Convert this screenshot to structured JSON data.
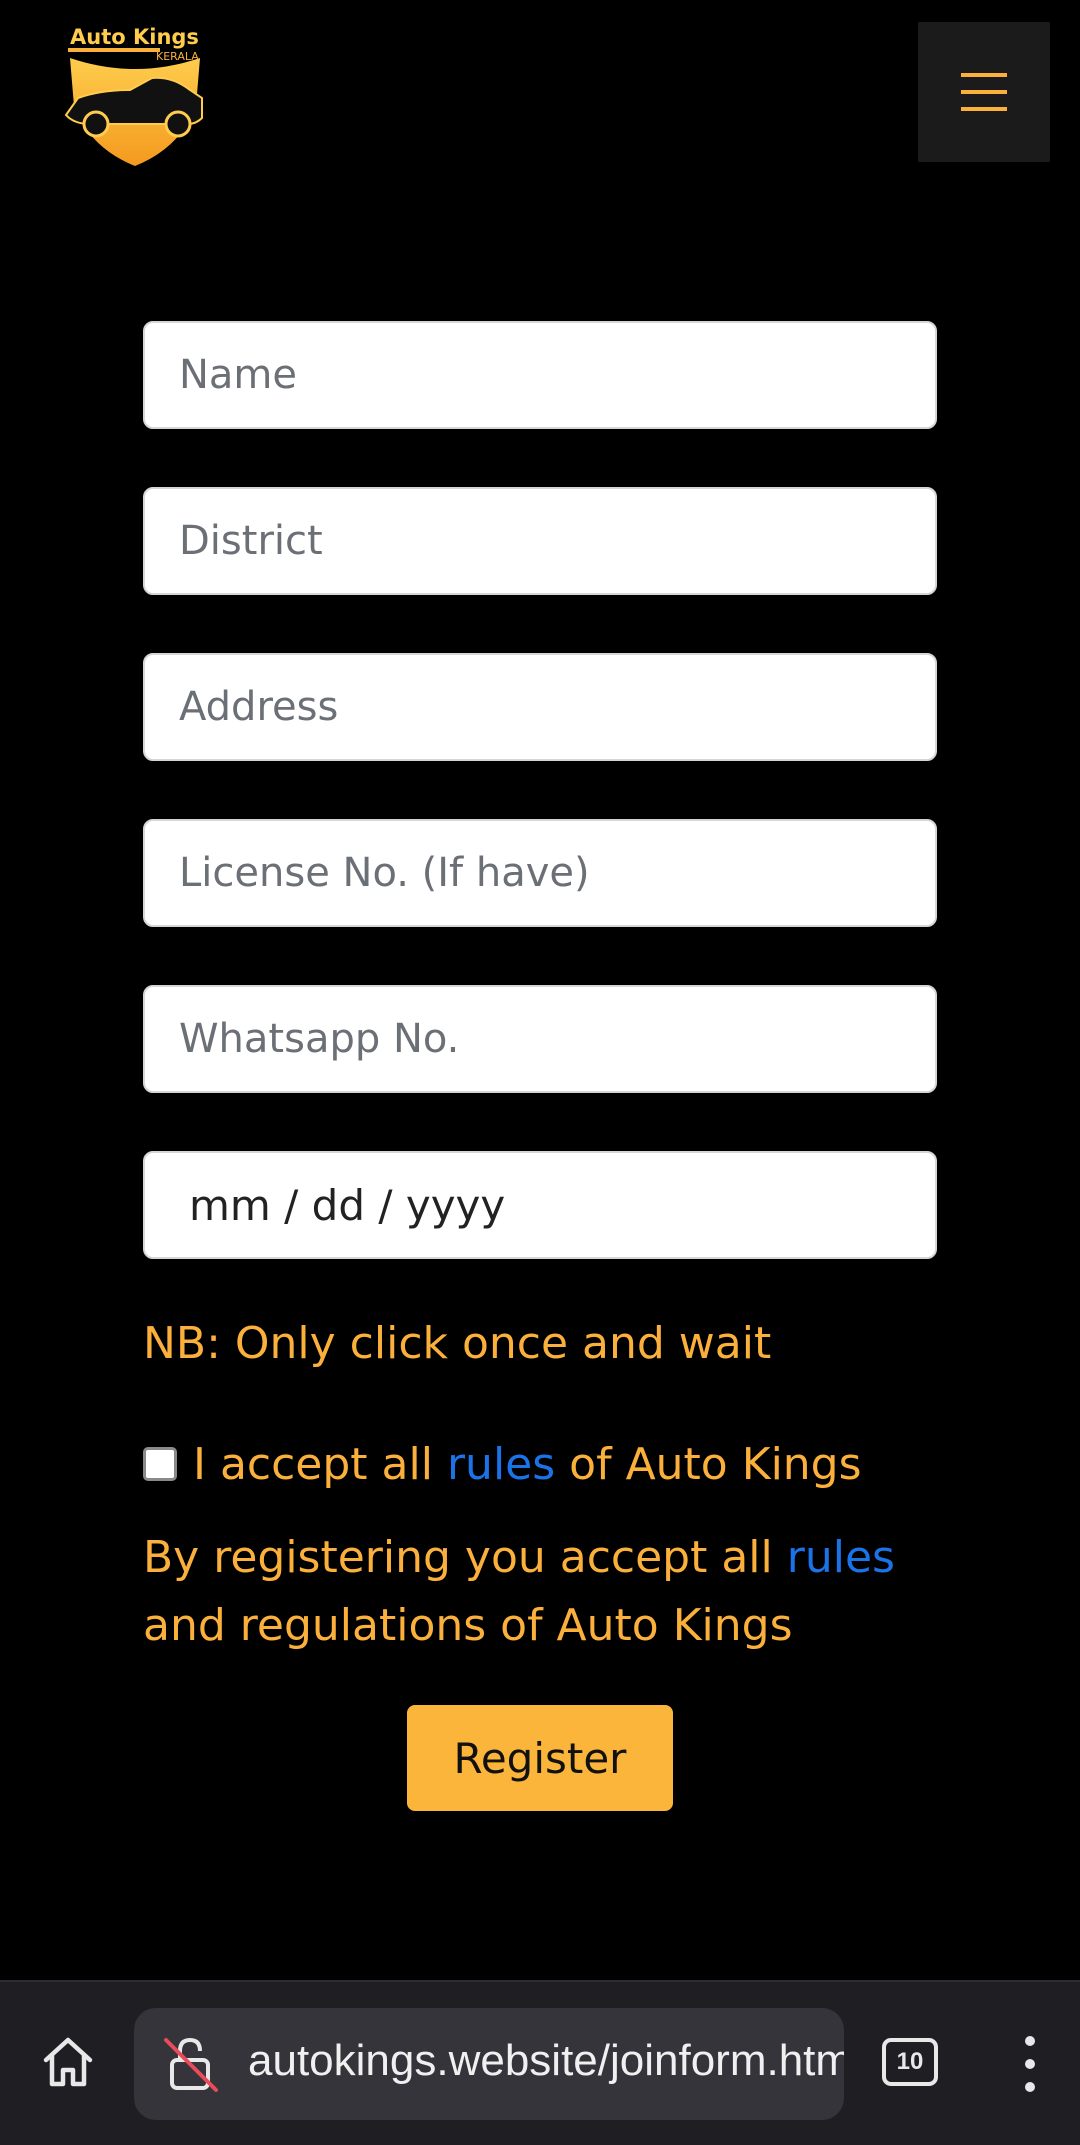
{
  "header": {
    "logo": {
      "title": "Auto Kings",
      "subtitle": "KERALA",
      "icon": "car-shield-logo"
    },
    "menu_icon": "hamburger-menu-icon"
  },
  "form": {
    "name_placeholder": "Name",
    "district_placeholder": "District",
    "address_placeholder": "Address",
    "license_placeholder": "License No. (If have)",
    "whatsapp_placeholder": "Whatsapp No.",
    "date_placeholder": "mm / dd / yyyy"
  },
  "note": "NB: Only click once and wait",
  "accept": {
    "prefix": "I accept all",
    "link": "rules",
    "suffix": "of Auto Kings",
    "checked": false
  },
  "terms": {
    "prefix": "By registering you accept all",
    "link": "rules",
    "suffix": "and regulations of Auto Kings"
  },
  "register_label": "Register",
  "browser": {
    "url": "autokings.website/joinform.html",
    "tab_count": "10",
    "icons": [
      "home-icon",
      "insecure-lock-icon",
      "tabs-icon",
      "more-options-icon"
    ]
  },
  "colors": {
    "accent": "#fbb03b",
    "link": "#1a73e8",
    "background": "#000000"
  }
}
